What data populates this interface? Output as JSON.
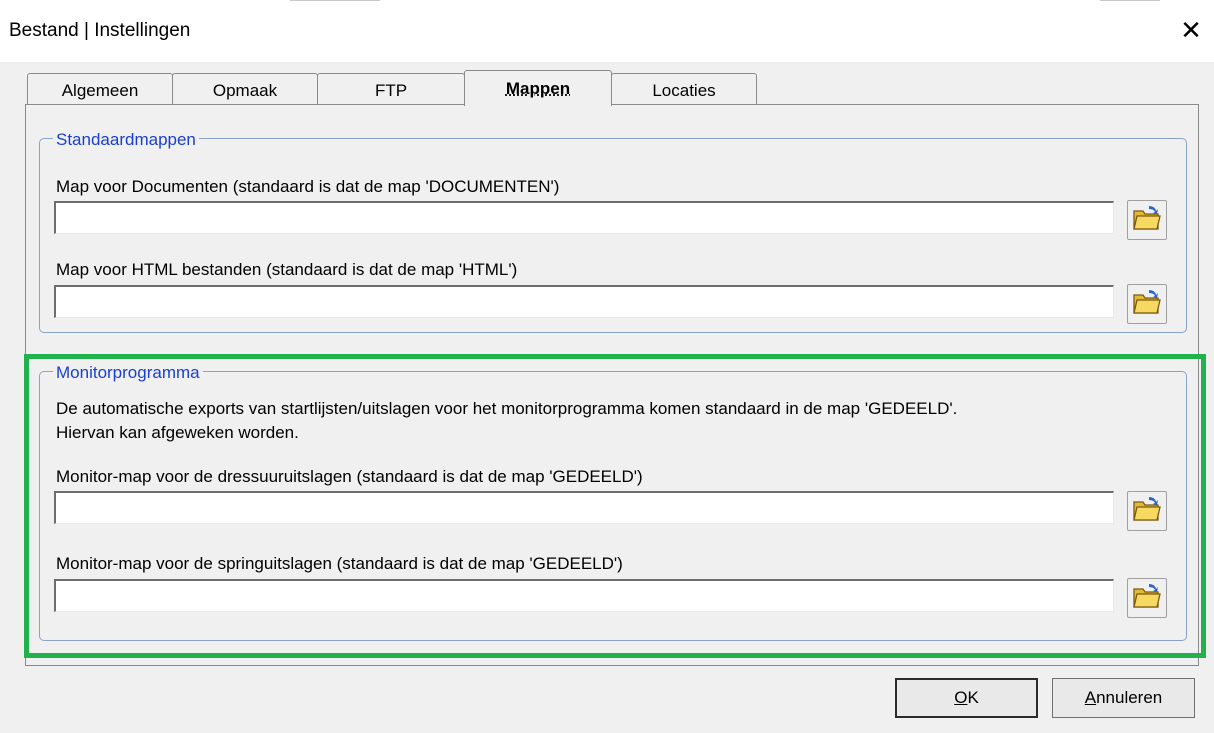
{
  "window": {
    "title": "Bestand | Instellingen",
    "close_glyph": "✕"
  },
  "tabs": [
    {
      "label": "Algemeen",
      "active": false
    },
    {
      "label": "Opmaak",
      "active": false
    },
    {
      "label": "FTP",
      "active": false
    },
    {
      "label": "Mappen",
      "active": true
    },
    {
      "label": "Locaties",
      "active": false
    }
  ],
  "standaardmappen": {
    "legend": "Standaardmappen",
    "documenten": {
      "label": "Map voor Documenten (standaard is dat de map 'DOCUMENTEN')",
      "value": ""
    },
    "html": {
      "label": "Map voor HTML bestanden (standaard is dat de map 'HTML')",
      "value": ""
    }
  },
  "monitor": {
    "legend": "Monitorprogramma",
    "description_line1": "De automatische exports van startlijsten/uitslagen voor het monitorprogramma komen standaard in de map 'GEDEELD'.",
    "description_line2": "Hiervan kan afgeweken worden.",
    "dressuur": {
      "label": "Monitor-map voor de dressuuruitslagen (standaard is dat de map 'GEDEELD')",
      "value": ""
    },
    "spring": {
      "label": "Monitor-map voor de springuitslagen (standaard is dat de map 'GEDEELD')",
      "value": ""
    }
  },
  "footer": {
    "ok_access": "O",
    "ok_rest": "K",
    "cancel_access": "A",
    "cancel_rest": "nnuleren"
  },
  "icons": {
    "browse": "folder-open-icon",
    "highlight_color": "#22b14c",
    "legend_color": "#1a3fd0"
  }
}
